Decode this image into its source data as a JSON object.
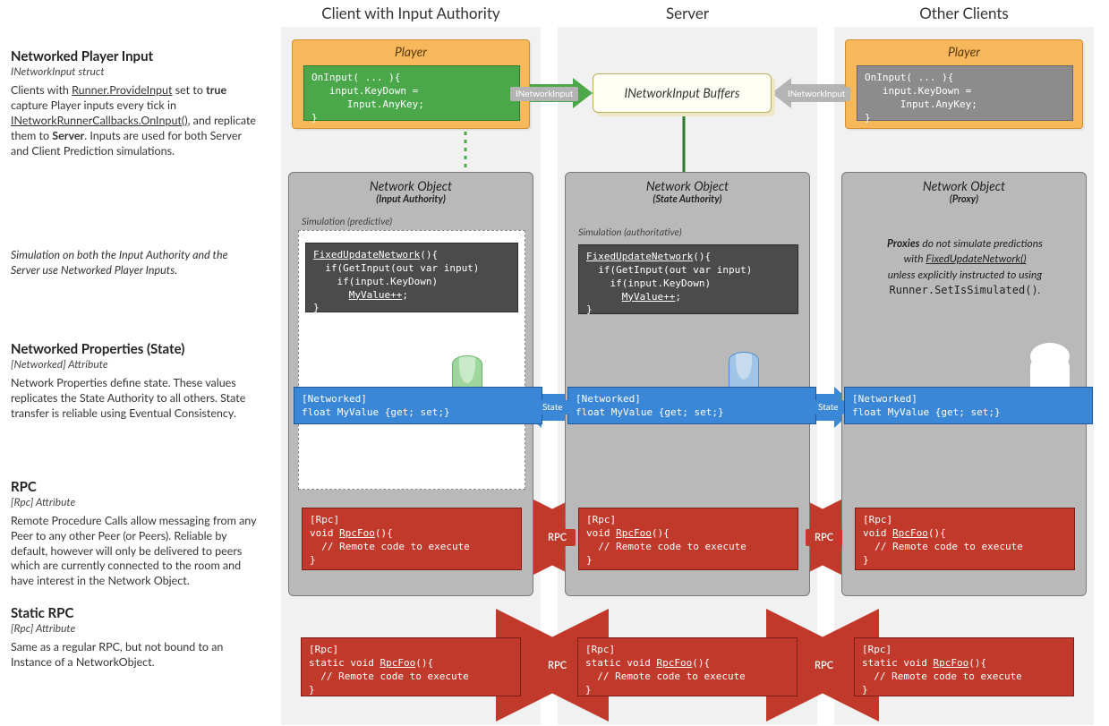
{
  "cols": {
    "a": "Client with Input Authority",
    "b": "Server",
    "c": "Other Clients"
  },
  "left": {
    "s1": {
      "title": "Networked Player Input",
      "sub": "INetworkInput struct",
      "body_html": "Clients with <u>Runner.ProvideInput</u> set to <b>true</b> capture Player inputs every tick in <u>INetworkRunnerCallbacks.OnInput()</u>, and replicate them to <b>Server</b>. Inputs are used for both Server and Client Prediction simulations."
    },
    "s2": {
      "body_html": "<i>Simulation on both the Input Authority and the Server use Networked Player Inputs.</i>"
    },
    "s3": {
      "title": "Networked Properties (State)",
      "sub": "[Networked] Attribute",
      "body_html": "Network Properties define state. These values replicates the State Authority to all others. State transfer is reliable using Eventual Consistency."
    },
    "s4": {
      "title": "RPC",
      "sub": "[Rpc] Attribute",
      "body_html": "Remote Procedure Calls allow messaging from any Peer to any other Peer (or Peers). Reliable by default, however will only be delivered to peers which are currently connected to the room and have interest in  the Network Object."
    },
    "s5": {
      "title": "Static RPC",
      "sub": "[Rpc] Attribute",
      "body_html": "Same as a regular RPC, but not bound to an Instance of a NetworkObject."
    }
  },
  "player": {
    "title": "Player",
    "code_oninput": "OnInput( ... ){\n   input.KeyDown =\n      Input.AnyKey;\n}"
  },
  "buffers_label": "INetworkInput Buffers",
  "arrow_labels": {
    "inetworkinput": "INetworkInput",
    "state": "State",
    "rpc": "RPC"
  },
  "netobj": {
    "title": "Network Object",
    "sub_ia": "(Input Authority)",
    "sub_sa": "(State Authority)",
    "sub_pr": "(Proxy)",
    "sim_pred": "Simulation (predictive)",
    "sim_auth": "Simulation (authoritative)",
    "code_fun": "FixedUpdateNetwork(){\n  if(GetInput(out var input)\n    if(input.KeyDown)\n      MyValue++;\n}",
    "code_networked": "[Networked]\nfloat MyValue {get; set;}",
    "code_rpc": "[Rpc]\nvoid RpcFoo(){\n  // Remote code to execute\n}",
    "code_static_rpc": "[Rpc]\nstatic void RpcFoo(){\n  // Remote code to execute\n}",
    "proxy_note_html": "<b><i>Proxies</i></b> <i>do not simulate predictions<br>with</i> <u><i>FixedUpdateNetwork()</i></u><br><i>unless explicitly instructed to using</i><br><code>Runner.SetIsSimulated()</code>."
  }
}
